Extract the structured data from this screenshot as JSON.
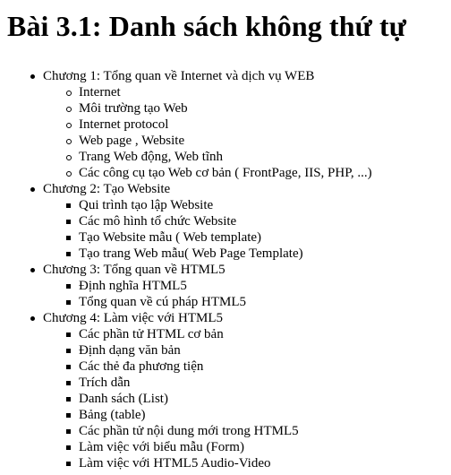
{
  "page_title": "Bài 3.1: Danh sách không thứ tự",
  "chapters": [
    {
      "title": "Chương 1: Tổng quan về Internet và dịch vụ WEB",
      "bullet_style": "circle",
      "topics": [
        "Internet",
        "Môi trường tạo Web",
        "Internet protocol",
        "Web page , Website",
        "Trang Web động, Web tĩnh",
        "Các công cụ tạo Web cơ bản ( FrontPage, IIS, PHP, ...)"
      ]
    },
    {
      "title": "Chương 2: Tạo Website",
      "bullet_style": "square",
      "topics": [
        "Qui trình tạo lập Website",
        "Các mô hình tổ chức Website",
        "Tạo Website mẫu ( Web template)",
        "Tạo trang Web mẫu( Web Page Template)"
      ]
    },
    {
      "title": "Chương 3: Tổng quan về HTML5",
      "bullet_style": "square",
      "topics": [
        "Định nghĩa HTML5",
        "Tổng quan về cú pháp HTML5"
      ]
    },
    {
      "title": "Chương 4: Làm việc với HTML5",
      "bullet_style": "square",
      "topics": [
        "Các phần tử HTML cơ bản",
        "Định dạng văn bản",
        "Các thẻ đa phương tiện",
        "Trích dẫn",
        "Danh sách (List)",
        "Bảng (table)",
        "Các phần tử nội dung mới trong HTML5",
        "Làm việc với biểu mẫu (Form)",
        "Làm việc với HTML5 Audio-Video"
      ]
    }
  ]
}
